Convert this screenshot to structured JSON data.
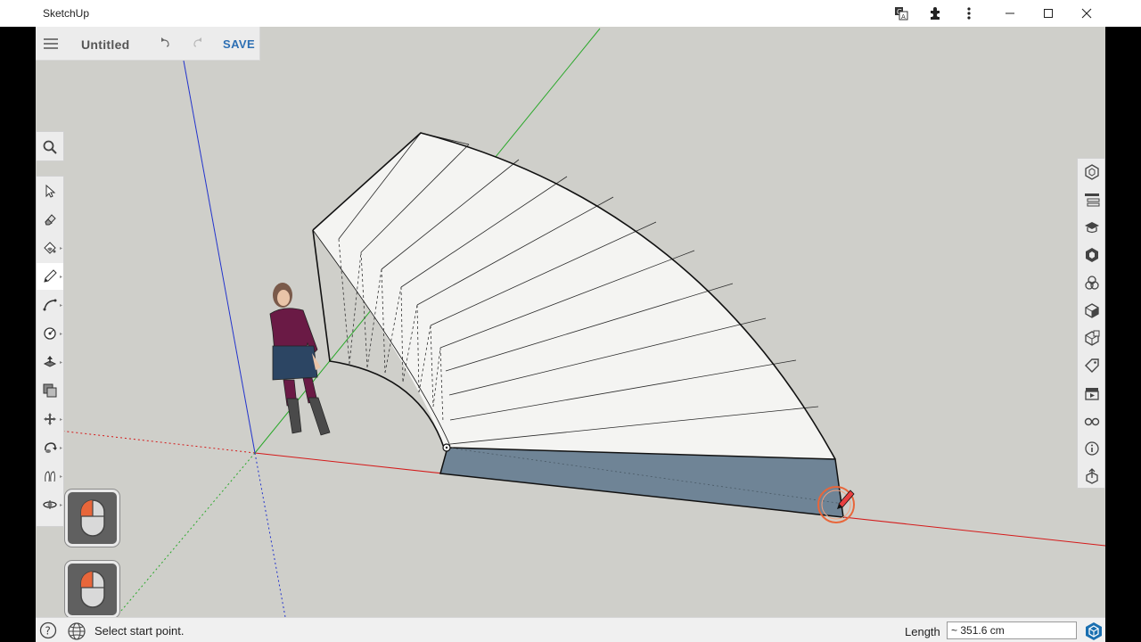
{
  "window": {
    "app_title": "SketchUp",
    "titlebar_icons": [
      "translate-icon",
      "extensions-icon",
      "more-vertical-icon"
    ],
    "window_buttons": [
      "minimize-icon",
      "maximize-icon",
      "close-icon"
    ]
  },
  "file": {
    "title": "Untitled",
    "save_label": "SAVE"
  },
  "left_toolbar": {
    "search": "search-icon",
    "tools": [
      "select-icon",
      "eraser-icon",
      "paint-bucket-icon",
      "pencil-icon",
      "arc-icon",
      "tape-measure-icon",
      "push-pull-icon",
      "offset-icon",
      "move-icon",
      "rotate-icon",
      "follow-me-icon",
      "orbit-icon"
    ],
    "active_tool": "pencil-icon"
  },
  "right_toolbar": {
    "icons": [
      "entity-info-icon",
      "outliner-icon",
      "instructor-icon",
      "components-icon",
      "materials-icon",
      "styles-icon",
      "scenes-icon",
      "tags-icon",
      "scenes-clapper-icon",
      "display-glasses-icon",
      "info-icon",
      "export-icon"
    ]
  },
  "status": {
    "message": "Select start point.",
    "measurement_label": "Length",
    "measurement_value": "~ 351.6 cm"
  },
  "colors": {
    "viewport_bg": "#cfcfca",
    "face_front": "#ffffff",
    "face_back": "#6f8496",
    "axis_red": "#d41a1a",
    "axis_green": "#2aa82a",
    "axis_blue": "#2233cc",
    "save_blue": "#2d6fb3",
    "inference_orange": "#e8663a"
  }
}
